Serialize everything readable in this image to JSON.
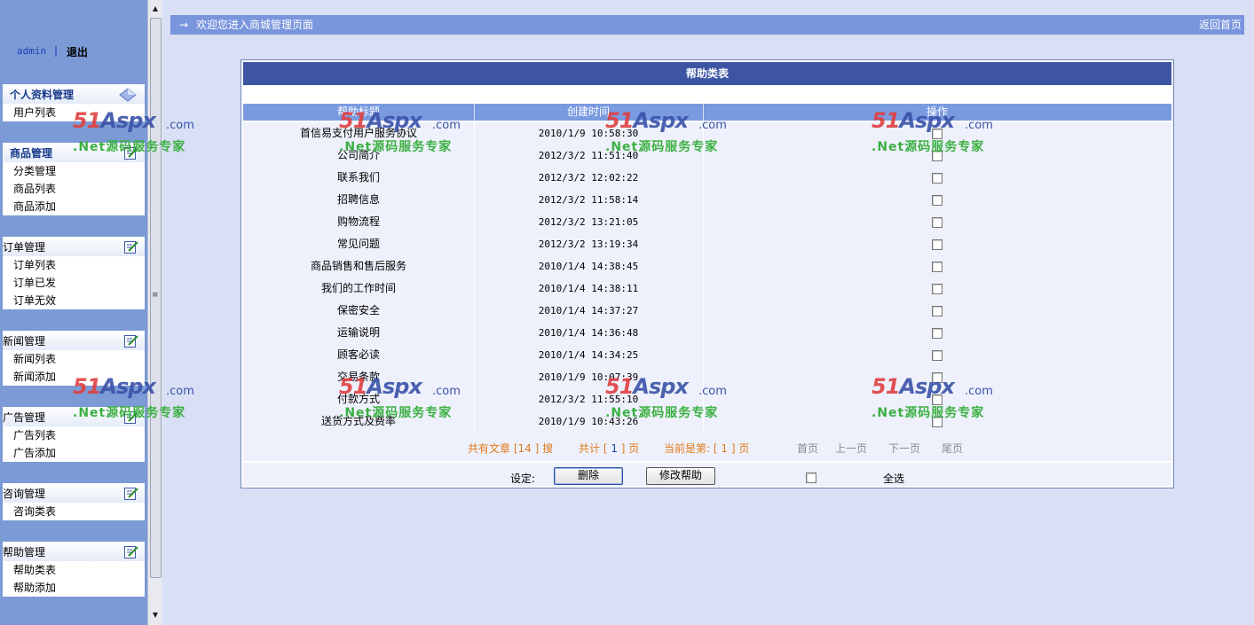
{
  "user": {
    "name": "admin",
    "separator": "|",
    "logout": "退出"
  },
  "sidebar": [
    {
      "title": "个人资料管理",
      "items": [
        "用户列表"
      ]
    },
    {
      "title": "商品管理",
      "items": [
        "分类管理",
        "商品列表",
        "商品添加"
      ]
    },
    {
      "title": "订单管理",
      "items": [
        "订单列表",
        "订单已发",
        "订单无效"
      ]
    },
    {
      "title": "新闻管理",
      "items": [
        "新闻列表",
        "新闻添加"
      ]
    },
    {
      "title": "广告管理",
      "items": [
        "广告列表",
        "广告添加"
      ]
    },
    {
      "title": "咨询管理",
      "items": [
        "咨询类表"
      ]
    },
    {
      "title": "帮助管理",
      "items": [
        "帮助类表",
        "帮助添加"
      ]
    }
  ],
  "topbar": {
    "arrow": "→",
    "welcome": "欢迎您进入商城管理页面",
    "home": "返回首页"
  },
  "table": {
    "title": "帮助类表",
    "headers": [
      "帮助标题",
      "创建时间",
      "操作"
    ],
    "rows": [
      {
        "title": "首信易支付用户服务协议",
        "time": "2010/1/9 10:58:30"
      },
      {
        "title": "公司简介",
        "time": "2012/3/2 11:51:40"
      },
      {
        "title": "联系我们",
        "time": "2012/3/2 12:02:22"
      },
      {
        "title": "招聘信息",
        "time": "2012/3/2 11:58:14"
      },
      {
        "title": "购物流程",
        "time": "2012/3/2 13:21:05"
      },
      {
        "title": "常见问题",
        "time": "2012/3/2 13:19:34"
      },
      {
        "title": "商品销售和售后服务",
        "time": "2010/1/4 14:38:45"
      },
      {
        "title": "我们的工作时间",
        "time": "2010/1/4 14:38:11"
      },
      {
        "title": "保密安全",
        "time": "2010/1/4 14:37:27"
      },
      {
        "title": "运输说明",
        "time": "2010/1/4 14:36:48"
      },
      {
        "title": "顾客必读",
        "time": "2010/1/4 14:34:25"
      },
      {
        "title": "交易条款",
        "time": "2010/1/9 10:07:39"
      },
      {
        "title": "付款方式",
        "time": "2012/3/2 11:55:10"
      },
      {
        "title": "送货方式及费率",
        "time": "2010/1/9 10:43:26"
      }
    ]
  },
  "pager": {
    "total_prefix": "共有文章",
    "total_count": "14",
    "total_suffix": "搜",
    "pages_prefix": "共计",
    "pages_count": "1",
    "pages_suffix": "页",
    "current_prefix": "当前是第:",
    "current_page": "1",
    "current_suffix": "页",
    "first": "首页",
    "prev": "上一页",
    "next": "下一页",
    "last": "尾页"
  },
  "actions": {
    "label": "设定:",
    "delete": "删除",
    "edit": "修改帮助",
    "select_all": "全选"
  },
  "watermark": {
    "logo_num": "51",
    "logo_text": "Aspx",
    "domain": ".com",
    "slogan": ".Net源码服务专家"
  },
  "icons": {
    "profile": "diamond-icon",
    "section": "edit-note-icon"
  }
}
